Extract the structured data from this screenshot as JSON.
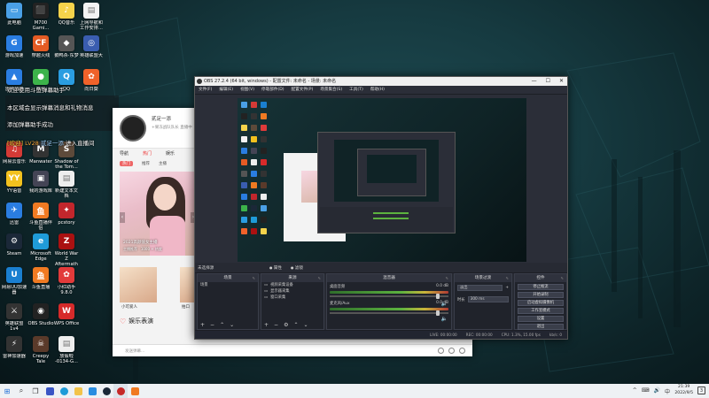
{
  "desktop": {
    "icons": [
      {
        "label": "此电脑",
        "color": "#4aa0e6",
        "glyph": "▭"
      },
      {
        "label": "M700\nGami...",
        "color": "#222",
        "glyph": "⬛"
      },
      {
        "label": "QQ音乐",
        "color": "#f5d34b",
        "glyph": "♪"
      },
      {
        "label": "上网导航和\n工作安排...",
        "color": "#f3f3f3",
        "glyph": "▤"
      },
      {
        "label": "游戏加速",
        "color": "#2a7de1",
        "glyph": "G"
      },
      {
        "label": "穿越火线",
        "color": "#e45b24",
        "glyph": "CF"
      },
      {
        "label": "鹅鸭杀·东梦",
        "color": "#555",
        "glyph": "◆"
      },
      {
        "label": "英雄联盟大",
        "color": "#3a5db0",
        "glyph": "◎"
      },
      {
        "label": "雷神加速",
        "color": "#2a7de1",
        "glyph": "▲"
      },
      {
        "label": "微信",
        "color": "#3cb34a",
        "glyph": "●"
      },
      {
        "label": "QQ",
        "color": "#2a9de1",
        "glyph": "Q"
      },
      {
        "label": "向日葵",
        "color": "#f0622a",
        "glyph": "✿"
      },
      {
        "label": "网易云音乐",
        "color": "#d43a36",
        "glyph": "♫"
      },
      {
        "label": "Manwater",
        "color": "#333",
        "glyph": "M"
      },
      {
        "label": "Shadow of\nthe Tom...",
        "color": "#5d4a3a",
        "glyph": "S"
      },
      {
        "label": "YY语音",
        "color": "#f2c11e",
        "glyph": "YY"
      },
      {
        "label": "我的游戏库",
        "color": "#445",
        "glyph": "▣"
      },
      {
        "label": "新建文本文\n档",
        "color": "#eee",
        "glyph": "▤"
      },
      {
        "label": "迅雷",
        "color": "#2a7de1",
        "glyph": "✈"
      },
      {
        "label": "斗鱼直播伴\n侣",
        "color": "#f07a22",
        "glyph": "鱼"
      },
      {
        "label": "pcstory",
        "color": "#c2262c",
        "glyph": "✦"
      },
      {
        "label": "Steam",
        "color": "#1b2838",
        "glyph": "⚙"
      },
      {
        "label": "Microsoft\nEdge",
        "color": "#1f9bd8",
        "glyph": "e"
      },
      {
        "label": "World War\nZ Aftermath",
        "color": "#a11",
        "glyph": "Z"
      },
      {
        "label": "网易UU加速器",
        "color": "#1a7fd0",
        "glyph": "U"
      },
      {
        "label": "斗鱼直播",
        "color": "#f07a22",
        "glyph": "鱼"
      },
      {
        "label": "小红助手\n9.8.0",
        "color": "#e23a3a",
        "glyph": "✿"
      },
      {
        "label": "英雄联盟\n1v4",
        "color": "#333",
        "glyph": "⚔"
      },
      {
        "label": "OBS Studio",
        "color": "#222",
        "glyph": "◉"
      },
      {
        "label": "WPS Office",
        "color": "#d62a2a",
        "glyph": "W"
      },
      {
        "label": "雷神加速器",
        "color": "#333",
        "glyph": "⚡"
      },
      {
        "label": "Creepy Tale",
        "color": "#5a3a2a",
        "glyph": "☠"
      },
      {
        "label": "放假啦\n-0134-G...",
        "color": "#eee",
        "glyph": "▤"
      }
    ],
    "danmaku": [
      {
        "text": "欢迎使用斗鱼弹幕助手",
        "color": "#ffffff"
      },
      {
        "text": "本区域会显示弹幕消息和礼物消息",
        "color": "#ffffff"
      },
      {
        "text": "添加弹幕助手成功",
        "color": "#ffffff"
      },
      {
        "text": "[欢迎]",
        "color": "#f2d23b"
      },
      {
        "text": "LV28",
        "color": "#f2a73b"
      },
      {
        "text": "贰足一添",
        "color": "#9fd3ff"
      },
      {
        "text": "进入直播间",
        "color": "#ffffff"
      }
    ]
  },
  "app": {
    "username": "贰足一添",
    "subline": "+果冻战队队长 直播中",
    "tabs": [
      "导航",
      "热门",
      "娱乐"
    ],
    "subtabs": [
      "热门",
      "推荐",
      "主播"
    ],
    "banner_caption": "2021高颜值女主播",
    "banner_caption2": "主播推荐 · 1000 + 热度",
    "thumb_labels": [
      "小可爱人",
      "拍口"
    ],
    "section_title": "娱乐表演",
    "input_placeholder": "发送弹幕..."
  },
  "obs": {
    "title": "OBS 27.2.4 (64 bit, windows) - 配置文件: 未命名 - 场景: 未命名",
    "win_min": "—",
    "win_max": "☐",
    "win_close": "✕",
    "menu": [
      "文件(F)",
      "编辑(E)",
      "视图(V)",
      "停靠部件(D)",
      "配置文件(P)",
      "场景集合(S)",
      "工具(T)",
      "帮助(H)"
    ],
    "scene_label": "未选择源",
    "scene_props": [
      "属性",
      "滤镜"
    ],
    "docks": {
      "scenes": {
        "title": "场景",
        "items": [
          "场景"
        ]
      },
      "sources": {
        "title": "来源",
        "items": [
          "视频采集设备",
          "显示器采集",
          "窗口采集"
        ]
      },
      "mixer": {
        "title": "混音器",
        "tracks": [
          {
            "name": "桌面音频",
            "db": "0.0 dB"
          },
          {
            "name": "麦克风/Aux",
            "db": "0.0 dB"
          }
        ]
      },
      "transitions": {
        "title": "场景过渡",
        "type": "淡出",
        "duration_label": "时长",
        "duration": "300 ms"
      },
      "controls": {
        "title": "控件",
        "buttons": [
          "停止推流",
          "开始录制",
          "启动虚拟摄像机",
          "工作室模式",
          "设置",
          "退出"
        ]
      }
    },
    "status": {
      "live": "LIVE: 00:00:00",
      "rec": "REC: 00:00:00",
      "cpu": "CPU: 1.3%, 15.00 fps",
      "kbps": "kb/s: 0"
    }
  },
  "taskbar": {
    "start_glyph": "⊞",
    "search_glyph": "⌕",
    "view_glyph": "❐",
    "time": "21:39",
    "date": "2022/9/5",
    "tray": [
      "^",
      "⌨",
      "🔊",
      "中"
    ],
    "notify": "3"
  }
}
